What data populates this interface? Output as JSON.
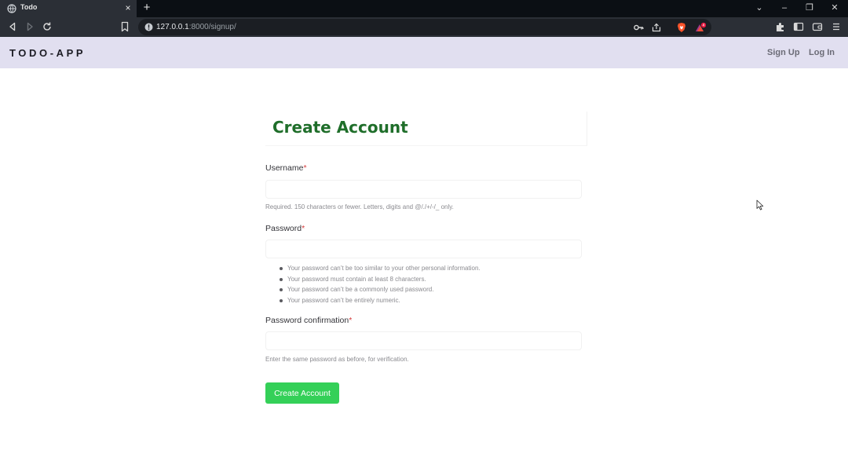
{
  "browser": {
    "tab_title": "Todo",
    "tab_close_glyph": "×",
    "new_tab_glyph": "+",
    "url_host": "127.0.0.1",
    "url_rest": ":8000/signup/",
    "window_controls": [
      "⌄",
      "–",
      "❐",
      "✕"
    ],
    "icons": [
      "globe-icon",
      "back-icon",
      "forward-icon",
      "reload-icon",
      "bookmark-icon",
      "info-icon",
      "key-icon",
      "share-icon",
      "brave-shield-icon",
      "brave-rewards-icon",
      "extensions-icon",
      "sidebar-icon",
      "wallet-icon",
      "menu-icon"
    ],
    "rewards_badge": "4",
    "accent": "#fb542b"
  },
  "header": {
    "brand": "TODO-APP",
    "nav": {
      "signup": "Sign Up",
      "login": "Log In"
    },
    "background": "#e1dff0"
  },
  "form": {
    "title": "Create Account",
    "title_color": "#1f6e2a",
    "username": {
      "label": "Username",
      "required_mark": "*",
      "value": "",
      "help": "Required. 150 characters or fewer. Letters, digits and @/./+/-/_ only."
    },
    "password": {
      "label": "Password",
      "required_mark": "*",
      "value": "",
      "help_items": [
        "Your password can’t be too similar to your other personal information.",
        "Your password must contain at least 8 characters.",
        "Your password can’t be a commonly used password.",
        "Your password can’t be entirely numeric."
      ]
    },
    "password_confirmation": {
      "label": "Password confirmation",
      "required_mark": "*",
      "value": "",
      "help": "Enter the same password as before, for verification."
    },
    "submit_label": "Create Account",
    "submit_color": "#34d058"
  }
}
